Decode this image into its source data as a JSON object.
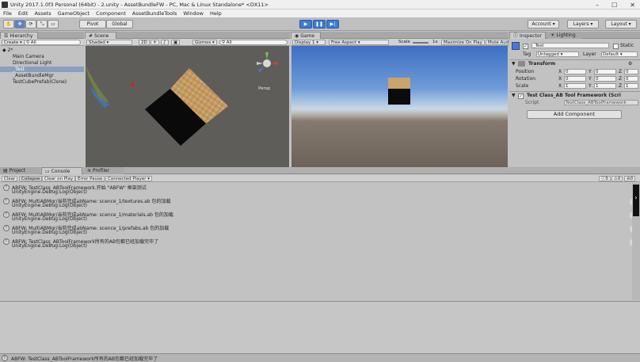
{
  "window": {
    "title": "Unity 2017.1.0f3 Personal (64bit) - 2.unity - AssetBundleFW - PC, Mac & Linux Standalone* <DX11>",
    "controls": [
      "–",
      "☐",
      "✕"
    ]
  },
  "menu": [
    "File",
    "Edit",
    "Assets",
    "GameObject",
    "Component",
    "AssetBundleTools",
    "Window",
    "Help"
  ],
  "toolbar": {
    "pivot": "Pivot",
    "global": "Global",
    "account": "Account",
    "layers": "Layers",
    "layout": "Layout"
  },
  "hierarchy": {
    "tab": "Hierarchy",
    "create": "Create",
    "search_prefix": "All",
    "scene_name": "2*",
    "items": [
      "Main Camera",
      "Directional Light",
      "_Test",
      "_AssetBundleMgr",
      "TestCubePrefab(Clone)"
    ]
  },
  "scene": {
    "tab": "Scene",
    "shading": "Shaded",
    "mode2d": "2D",
    "gizmos": "Gizmos",
    "search_prefix": "All",
    "persp": "Persp"
  },
  "game": {
    "tab": "Game",
    "display": "Display 1",
    "aspect": "Free Aspect",
    "scale_label": "Scale",
    "scale_value": "1x",
    "maximize": "Maximize On Play",
    "mute": "Mute Audi"
  },
  "inspector": {
    "tab": "Inspector",
    "tab2": "Lighting",
    "object_name": "_Test",
    "static_label": "Static",
    "tag_label": "Tag",
    "tag_value": "Untagged",
    "layer_label": "Layer",
    "layer_value": "Default",
    "transform_title": "Transform",
    "rows": [
      {
        "label": "Position",
        "x": "0",
        "y": "0",
        "z": "0"
      },
      {
        "label": "Rotation",
        "x": "0",
        "y": "0",
        "z": "0"
      },
      {
        "label": "Scale",
        "x": "1",
        "y": "1",
        "z": "1"
      }
    ],
    "script_component": "Test Class_AB Tool Framework (Scri",
    "script_label": "Script",
    "script_value": "TestClass_ABToolFramework",
    "add_component": "Add Component"
  },
  "console": {
    "tabs": [
      "Project",
      "Console",
      "Profiler"
    ],
    "buttons": [
      "Clear",
      "Collapse",
      "Clear on Play",
      "Error Pause",
      "Connected Player"
    ],
    "counts": {
      "info": "5",
      "warn": "0",
      "error": "0"
    },
    "entries": [
      {
        "line1": "ABFW: TestClass_ABToolFramework.开始 \"ABFW\" 框架测试",
        "line2": "UnityEngine.Debug:Log(Object)",
        "count": ""
      },
      {
        "line1": "ABFW: MultiABMgr/当前完成abName: scence_1/textures.ab 包的加载",
        "line2": "UnityEngine.Debug:Log(Object)",
        "count": "1"
      },
      {
        "line1": "ABFW: MultiABMgr/当前完成abName: scence_1/materials.ab 包的加载",
        "line2": "UnityEngine.Debug:Log(Object)",
        "count": "1"
      },
      {
        "line1": "ABFW: MultiABMgr/当前完成abName: scence_1/prefabs.ab 包的加载",
        "line2": "UnityEngine.Debug:Log(Object)",
        "count": "1"
      },
      {
        "line1": "ABFW: TestClass_ABToolFramework所有的AB包都已经加载完毕了",
        "line2": "UnityEngine.Debug:Log(Object)",
        "count": "1"
      }
    ]
  },
  "status": {
    "text": "ABFW: TestClass_ABToolFramework所有的AB包都已经加载完毕了"
  }
}
